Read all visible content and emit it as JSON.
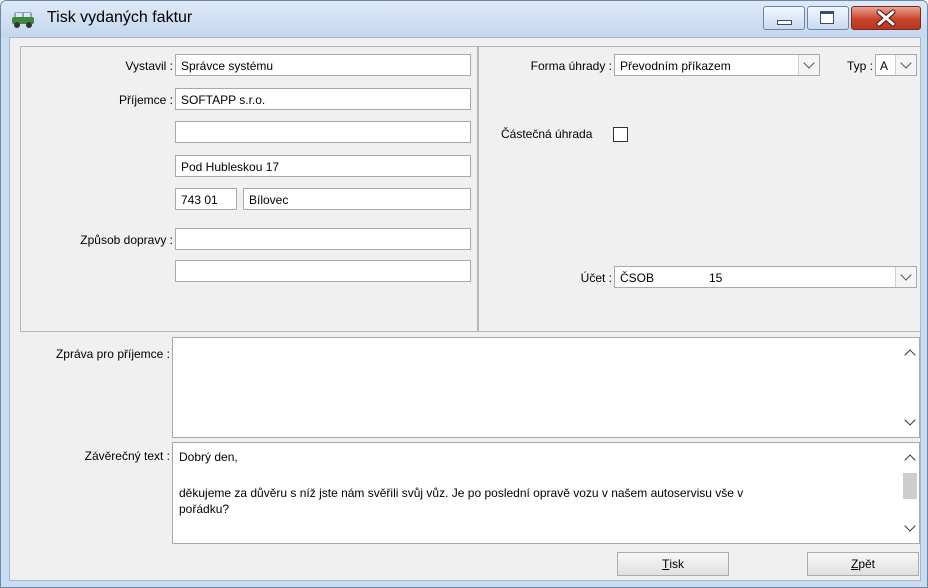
{
  "window": {
    "title": "Tisk vydaných faktur"
  },
  "left_group": {
    "vystavil": {
      "label": "Vystavil :",
      "value": "Správce systému"
    },
    "prijemce": {
      "label": "Příjemce :",
      "line1": "SOFTAPP s.r.o.",
      "line2": "",
      "street": "Pod Hubleskou 17",
      "zip": "743 01",
      "city": "Bílovec"
    },
    "doprava": {
      "label": "Způsob dopravy :",
      "line1": "",
      "line2": ""
    }
  },
  "right_group": {
    "forma_uhrady": {
      "label": "Forma úhrady :",
      "value": "Převodním příkazem"
    },
    "typ": {
      "label": "Typ :",
      "value": "A"
    },
    "castecna": {
      "label": "Částečná úhrada",
      "checked": false
    },
    "ucet": {
      "label": "Účet :",
      "bank": "ČSOB",
      "number": "15"
    }
  },
  "zprava": {
    "label": "Zpráva pro příjemce :",
    "value": ""
  },
  "zaverecny": {
    "label": "Závěrečný text :",
    "lines": [
      "Dobrý den,",
      "děkujeme za důvěru s níž jste nám svěřili svůj vůz. Je po poslední opravě vozu v našem autoservisu vše v",
      "pořádku?"
    ]
  },
  "buttons": {
    "tisk_first": "T",
    "tisk_rest": "isk",
    "zpet_first": "Z",
    "zpet_rest": "pět"
  }
}
